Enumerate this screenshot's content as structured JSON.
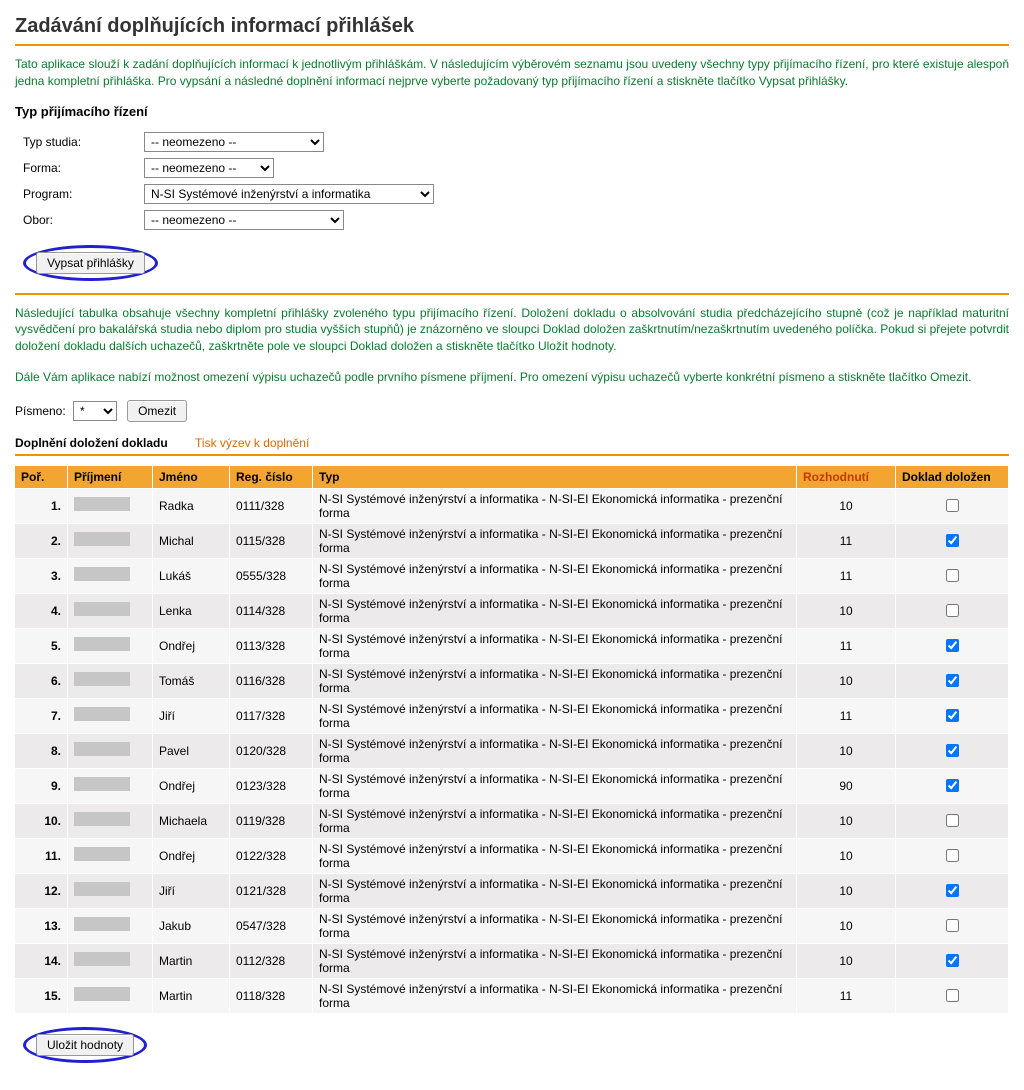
{
  "header": {
    "title": "Zadávání doplňujících informací přihlášek"
  },
  "intro1": "Tato aplikace slouží k zadání doplňujících informací k jednotlivým přihláškám. V následujícím výběrovém seznamu jsou uvedeny všechny typy přijímacího řízení, pro které existuje alespoň jedna kompletní přihláška. Pro vypsání a následné doplnění informací nejprve vyberte požadovaný typ přijímacího řízení a stiskněte tlačítko Vypsat přihlášky.",
  "section_title": "Typ přijímacího řízení",
  "filters": {
    "typ_label": "Typ studia:",
    "typ_value": "-- neomezeno --",
    "forma_label": "Forma:",
    "forma_value": "-- neomezeno --",
    "program_label": "Program:",
    "program_value": "N-SI Systémové inženýrství a informatika",
    "obor_label": "Obor:",
    "obor_value": "-- neomezeno --"
  },
  "buttons": {
    "vypsat": "Vypsat přihlášky",
    "omezit": "Omezit",
    "ulozit": "Uložit hodnoty"
  },
  "intro2": "Následující tabulka obsahuje všechny kompletní přihlášky zvoleného typu přijímacího řízení. Doložení dokladu o absolvování studia předcházejícího stupně (což je například maturitní vysvědčení pro bakalářská studia nebo diplom pro studia vyšších stupňů) je znázorněno ve sloupci Doklad doložen zaškrtnutím/nezaškrtnutím uvedeného políčka. Pokud si přejete potvrdit doložení dokladu dalších uchazečů, zaškrtněte pole ve sloupci Doklad doložen a stiskněte tlačítko Uložit hodnoty.",
  "intro3": "Dále Vám aplikace nabízí možnost omezení výpisu uchazečů podle prvního písmene příjmení. Pro omezení výpisu uchazečů vyberte konkrétní písmeno a stiskněte tlačítko Omezit.",
  "letter_filter": {
    "label": "Písmeno:",
    "value": "*"
  },
  "tabs": {
    "active": "Doplnění doložení dokladu",
    "inactive": "Tisk výzev k doplnění"
  },
  "table": {
    "headers": {
      "por": "Poř.",
      "prijmeni": "Příjmení",
      "jmeno": "Jméno",
      "reg": "Reg. číslo",
      "typ": "Typ",
      "rozhodnuti": "Rozhodnutí",
      "doklad": "Doklad doložen"
    },
    "rows": [
      {
        "por": "1.",
        "jmeno": "Radka",
        "reg": "0111/328",
        "typ": "N-SI Systémové inženýrství a informatika - N-SI-EI Ekonomická informatika - prezenční forma",
        "rozh": "10",
        "chk": false
      },
      {
        "por": "2.",
        "jmeno": "Michal",
        "reg": "0115/328",
        "typ": "N-SI Systémové inženýrství a informatika - N-SI-EI Ekonomická informatika - prezenční forma",
        "rozh": "11",
        "chk": true
      },
      {
        "por": "3.",
        "jmeno": "Lukáš",
        "reg": "0555/328",
        "typ": "N-SI Systémové inženýrství a informatika - N-SI-EI Ekonomická informatika - prezenční forma",
        "rozh": "11",
        "chk": false
      },
      {
        "por": "4.",
        "jmeno": "Lenka",
        "reg": "0114/328",
        "typ": "N-SI Systémové inženýrství a informatika - N-SI-EI Ekonomická informatika - prezenční forma",
        "rozh": "10",
        "chk": false
      },
      {
        "por": "5.",
        "jmeno": "Ondřej",
        "reg": "0113/328",
        "typ": "N-SI Systémové inženýrství a informatika - N-SI-EI Ekonomická informatika - prezenční forma",
        "rozh": "11",
        "chk": true
      },
      {
        "por": "6.",
        "jmeno": "Tomáš",
        "reg": "0116/328",
        "typ": "N-SI Systémové inženýrství a informatika - N-SI-EI Ekonomická informatika - prezenční forma",
        "rozh": "10",
        "chk": true
      },
      {
        "por": "7.",
        "jmeno": "Jiří",
        "reg": "0117/328",
        "typ": "N-SI Systémové inženýrství a informatika - N-SI-EI Ekonomická informatika - prezenční forma",
        "rozh": "11",
        "chk": true
      },
      {
        "por": "8.",
        "jmeno": "Pavel",
        "reg": "0120/328",
        "typ": "N-SI Systémové inženýrství a informatika - N-SI-EI Ekonomická informatika - prezenční forma",
        "rozh": "10",
        "chk": true
      },
      {
        "por": "9.",
        "jmeno": "Ondřej",
        "reg": "0123/328",
        "typ": "N-SI Systémové inženýrství a informatika - N-SI-EI Ekonomická informatika - prezenční forma",
        "rozh": "90",
        "chk": true
      },
      {
        "por": "10.",
        "jmeno": "Michaela",
        "reg": "0119/328",
        "typ": "N-SI Systémové inženýrství a informatika - N-SI-EI Ekonomická informatika - prezenční forma",
        "rozh": "10",
        "chk": false
      },
      {
        "por": "11.",
        "jmeno": "Ondřej",
        "reg": "0122/328",
        "typ": "N-SI Systémové inženýrství a informatika - N-SI-EI Ekonomická informatika - prezenční forma",
        "rozh": "10",
        "chk": false
      },
      {
        "por": "12.",
        "jmeno": "Jiří",
        "reg": "0121/328",
        "typ": "N-SI Systémové inženýrství a informatika - N-SI-EI Ekonomická informatika - prezenční forma",
        "rozh": "10",
        "chk": true
      },
      {
        "por": "13.",
        "jmeno": "Jakub",
        "reg": "0547/328",
        "typ": "N-SI Systémové inženýrství a informatika - N-SI-EI Ekonomická informatika - prezenční forma",
        "rozh": "10",
        "chk": false
      },
      {
        "por": "14.",
        "jmeno": "Martin",
        "reg": "0112/328",
        "typ": "N-SI Systémové inženýrství a informatika - N-SI-EI Ekonomická informatika - prezenční forma",
        "rozh": "10",
        "chk": true
      },
      {
        "por": "15.",
        "jmeno": "Martin",
        "reg": "0118/328",
        "typ": "N-SI Systémové inženýrství a informatika - N-SI-EI Ekonomická informatika - prezenční forma",
        "rozh": "11",
        "chk": false
      }
    ]
  }
}
